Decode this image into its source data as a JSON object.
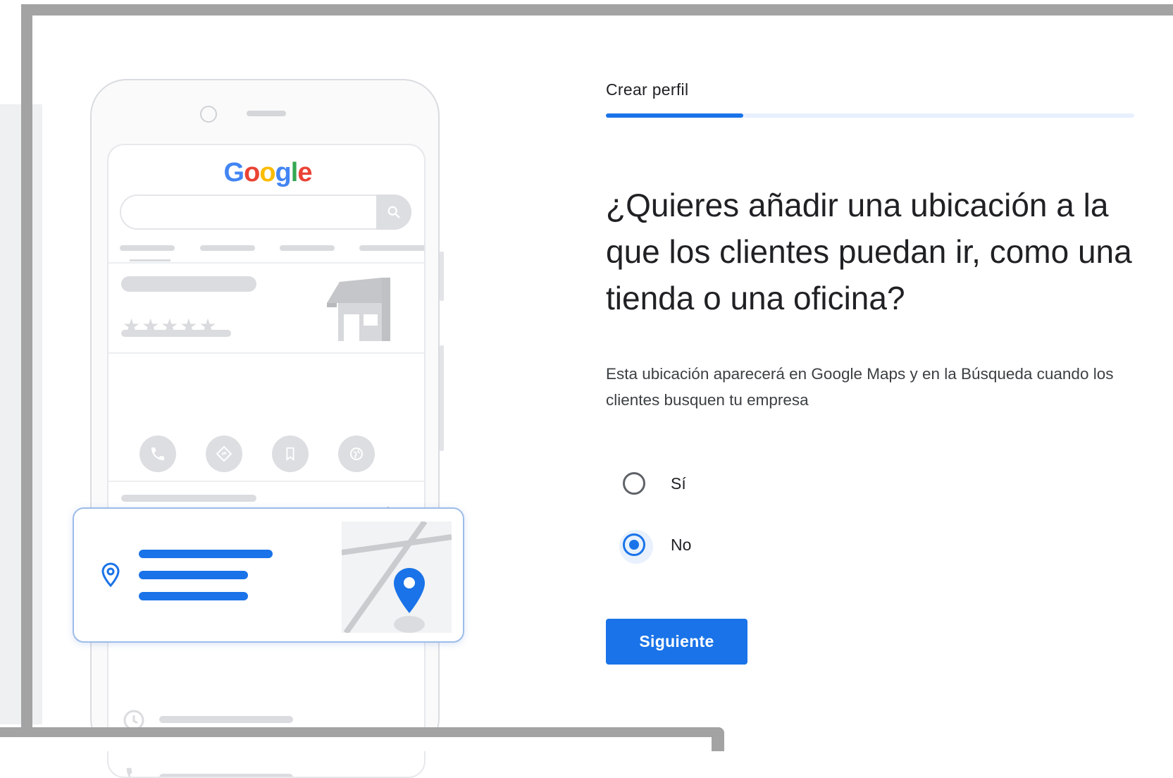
{
  "form": {
    "step_label": "Crear perfil",
    "progress_fraction": 0.26,
    "question": "¿Quieres añadir una ubicación a la que los clientes puedan ir, como una tienda o una oficina?",
    "description": "Esta ubicación aparecerá en Google Maps y en la Búsqueda cuando los clientes busquen tu empresa",
    "options": [
      {
        "label": "Sí",
        "selected": false
      },
      {
        "label": "No",
        "selected": true
      }
    ],
    "next_label": "Siguiente"
  },
  "illustration": {
    "logo_letters": [
      {
        "char": "G",
        "color": "#4285F4"
      },
      {
        "char": "o",
        "color": "#EA4335"
      },
      {
        "char": "o",
        "color": "#FBBC05"
      },
      {
        "char": "g",
        "color": "#4285F4"
      },
      {
        "char": "l",
        "color": "#34A853"
      },
      {
        "char": "e",
        "color": "#EA4335"
      }
    ],
    "stars": "★★★★★",
    "icons": [
      "search-icon",
      "phone-icon",
      "directions-icon",
      "bookmark-icon",
      "globe-icon",
      "chevron-right-icon",
      "location-pin-icon",
      "map-pin-icon",
      "clock-icon"
    ]
  },
  "colors": {
    "accent": "#1a73e8",
    "frame": "#a3a3a3",
    "text": "#202124"
  }
}
